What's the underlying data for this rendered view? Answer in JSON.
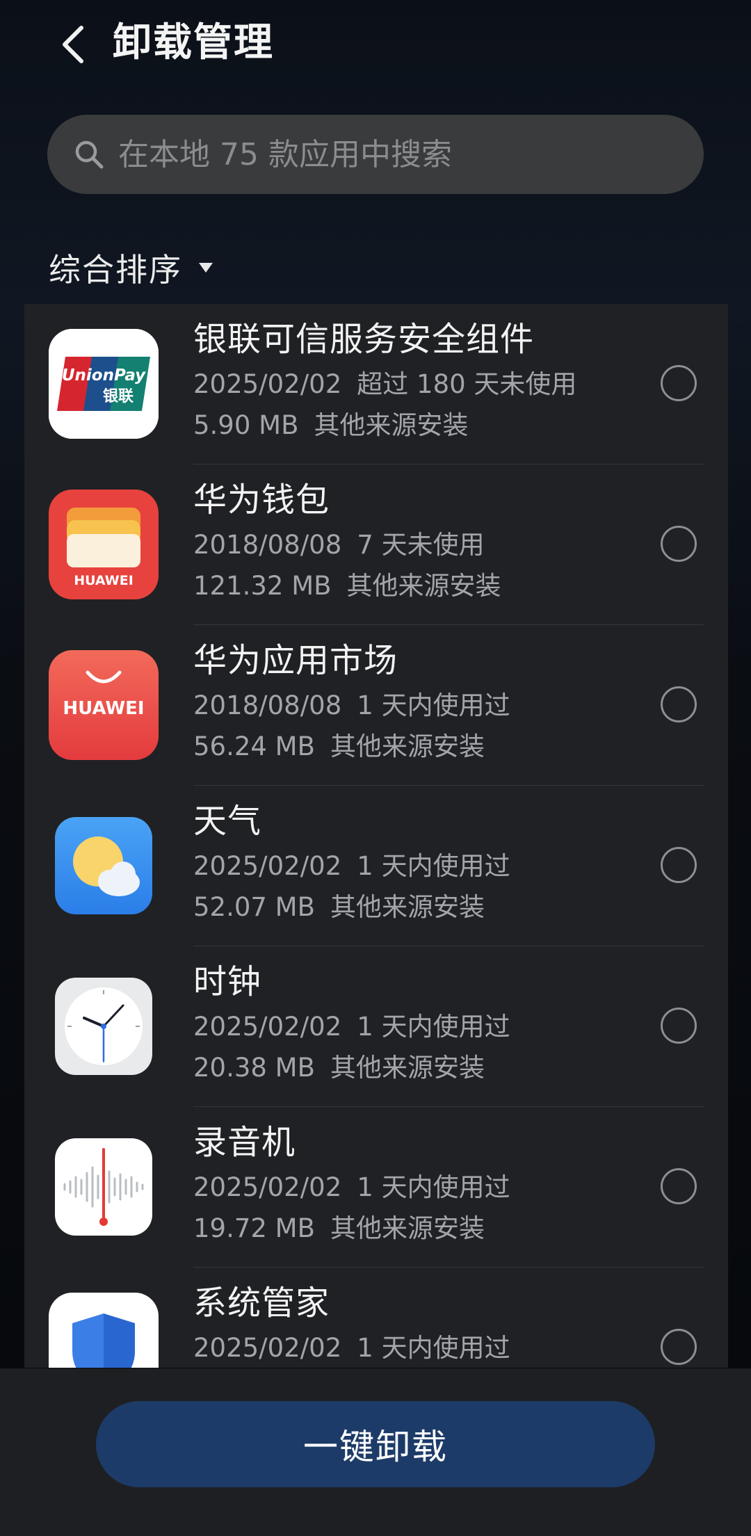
{
  "header": {
    "title": "卸载管理"
  },
  "search": {
    "placeholder": "在本地 75 款应用中搜索"
  },
  "sort": {
    "label": "综合排序"
  },
  "apps": [
    {
      "name": "银联可信服务安全组件",
      "date": "2025/02/02",
      "usage": "超过 180 天未使用",
      "size": "5.90 MB",
      "source": "其他来源安装",
      "icon": "unionpay-icon",
      "icon_text": "UnionPay 银联"
    },
    {
      "name": "华为钱包",
      "date": "2018/08/08",
      "usage": "7 天未使用",
      "size": "121.32 MB",
      "source": "其他来源安装",
      "icon": "huawei-wallet-icon",
      "icon_text": "HUAWEI"
    },
    {
      "name": "华为应用市场",
      "date": "2018/08/08",
      "usage": "1 天内使用过",
      "size": "56.24 MB",
      "source": "其他来源安装",
      "icon": "huawei-appgallery-icon",
      "icon_text": "HUAWEI"
    },
    {
      "name": "天气",
      "date": "2025/02/02",
      "usage": "1 天内使用过",
      "size": "52.07 MB",
      "source": "其他来源安装",
      "icon": "weather-icon"
    },
    {
      "name": "时钟",
      "date": "2025/02/02",
      "usage": "1 天内使用过",
      "size": "20.38 MB",
      "source": "其他来源安装",
      "icon": "clock-icon"
    },
    {
      "name": "录音机",
      "date": "2025/02/02",
      "usage": "1 天内使用过",
      "size": "19.72 MB",
      "source": "其他来源安装",
      "icon": "recorder-icon"
    },
    {
      "name": "系统管家",
      "date": "2025/02/02",
      "usage": "1 天内使用过",
      "size": "",
      "source": "",
      "icon": "system-manager-icon"
    }
  ],
  "footer": {
    "button_label": "一键卸载"
  },
  "colors": {
    "background": "#0a0d12",
    "list_bg": "#202124",
    "search_bg": "#3a3b3d",
    "button_bg": "#1d3b68",
    "secondary_text": "#a4a5a8"
  }
}
